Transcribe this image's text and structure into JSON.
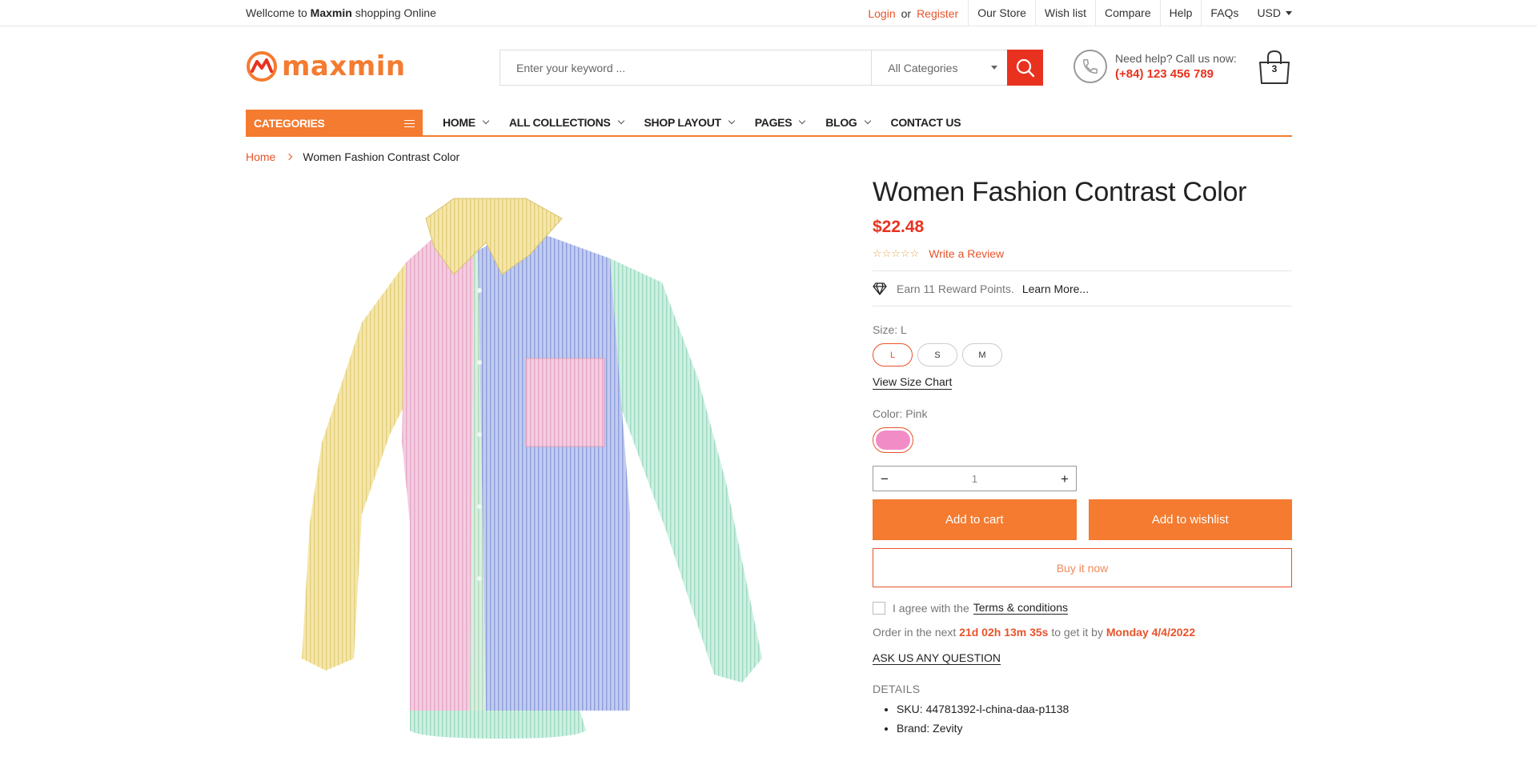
{
  "topbar": {
    "welcome_prefix": "Wellcome to",
    "brand": "Maxmin",
    "welcome_suffix": "shopping Online",
    "login": "Login",
    "or": "or",
    "register": "Register",
    "links": [
      "Our Store",
      "Wish list",
      "Compare",
      "Help",
      "FAQs"
    ],
    "currency": "USD"
  },
  "header": {
    "logo_text": "maxmin",
    "search_placeholder": "Enter your keyword ...",
    "category_select": "All Categories",
    "help_line1": "Need help? Call us now:",
    "help_phone": "(+84) 123 456 789",
    "cart_count": "3"
  },
  "nav": {
    "categories_label": "CATEGORIES",
    "items": [
      {
        "label": "HOME",
        "dropdown": true
      },
      {
        "label": "ALL COLLECTIONS",
        "dropdown": true
      },
      {
        "label": "SHOP LAYOUT",
        "dropdown": true
      },
      {
        "label": "PAGES",
        "dropdown": true
      },
      {
        "label": "BLOG",
        "dropdown": true
      },
      {
        "label": "CONTACT US",
        "dropdown": false
      }
    ]
  },
  "breadcrumb": {
    "home": "Home",
    "current": "Women Fashion Contrast Color"
  },
  "product": {
    "title": "Women Fashion Contrast Color",
    "price": "$22.48",
    "stars": "☆☆☆☆☆",
    "write_review": "Write a Review",
    "reward_text": "Earn 11 Reward Points.",
    "learn_more": "Learn More...",
    "size_label": "Size: L",
    "sizes": [
      "L",
      "S",
      "M"
    ],
    "selected_size": "L",
    "view_size_chart": "View Size Chart",
    "color_label": "Color: Pink",
    "color_swatch": "#f28cc6",
    "qty_value": "1",
    "qty_minus": "−",
    "qty_plus": "+",
    "add_to_cart": "Add to cart",
    "add_to_wishlist": "Add to wishlist",
    "buy_now": "Buy it now",
    "agree_text": "I agree with the",
    "terms": "Terms & conditions",
    "order_prefix": "Order in the next",
    "countdown": "21d 02h 13m 35s",
    "order_mid": "to get it by",
    "delivery_date": "Monday 4/4/2022",
    "ask_question": "ASK US ANY QUESTION",
    "details_heading": "DETAILS",
    "details": [
      "SKU: 44781392-l-china-daa-p1138",
      "Brand: Zevity"
    ]
  },
  "colors": {
    "accent": "#f47b30",
    "red": "#e8321f",
    "shirt_yellow": "#f3e3a0",
    "shirt_pink": "#f3c6dc",
    "shirt_blue": "#b8c4ec",
    "shirt_mint": "#c5ecdc"
  }
}
